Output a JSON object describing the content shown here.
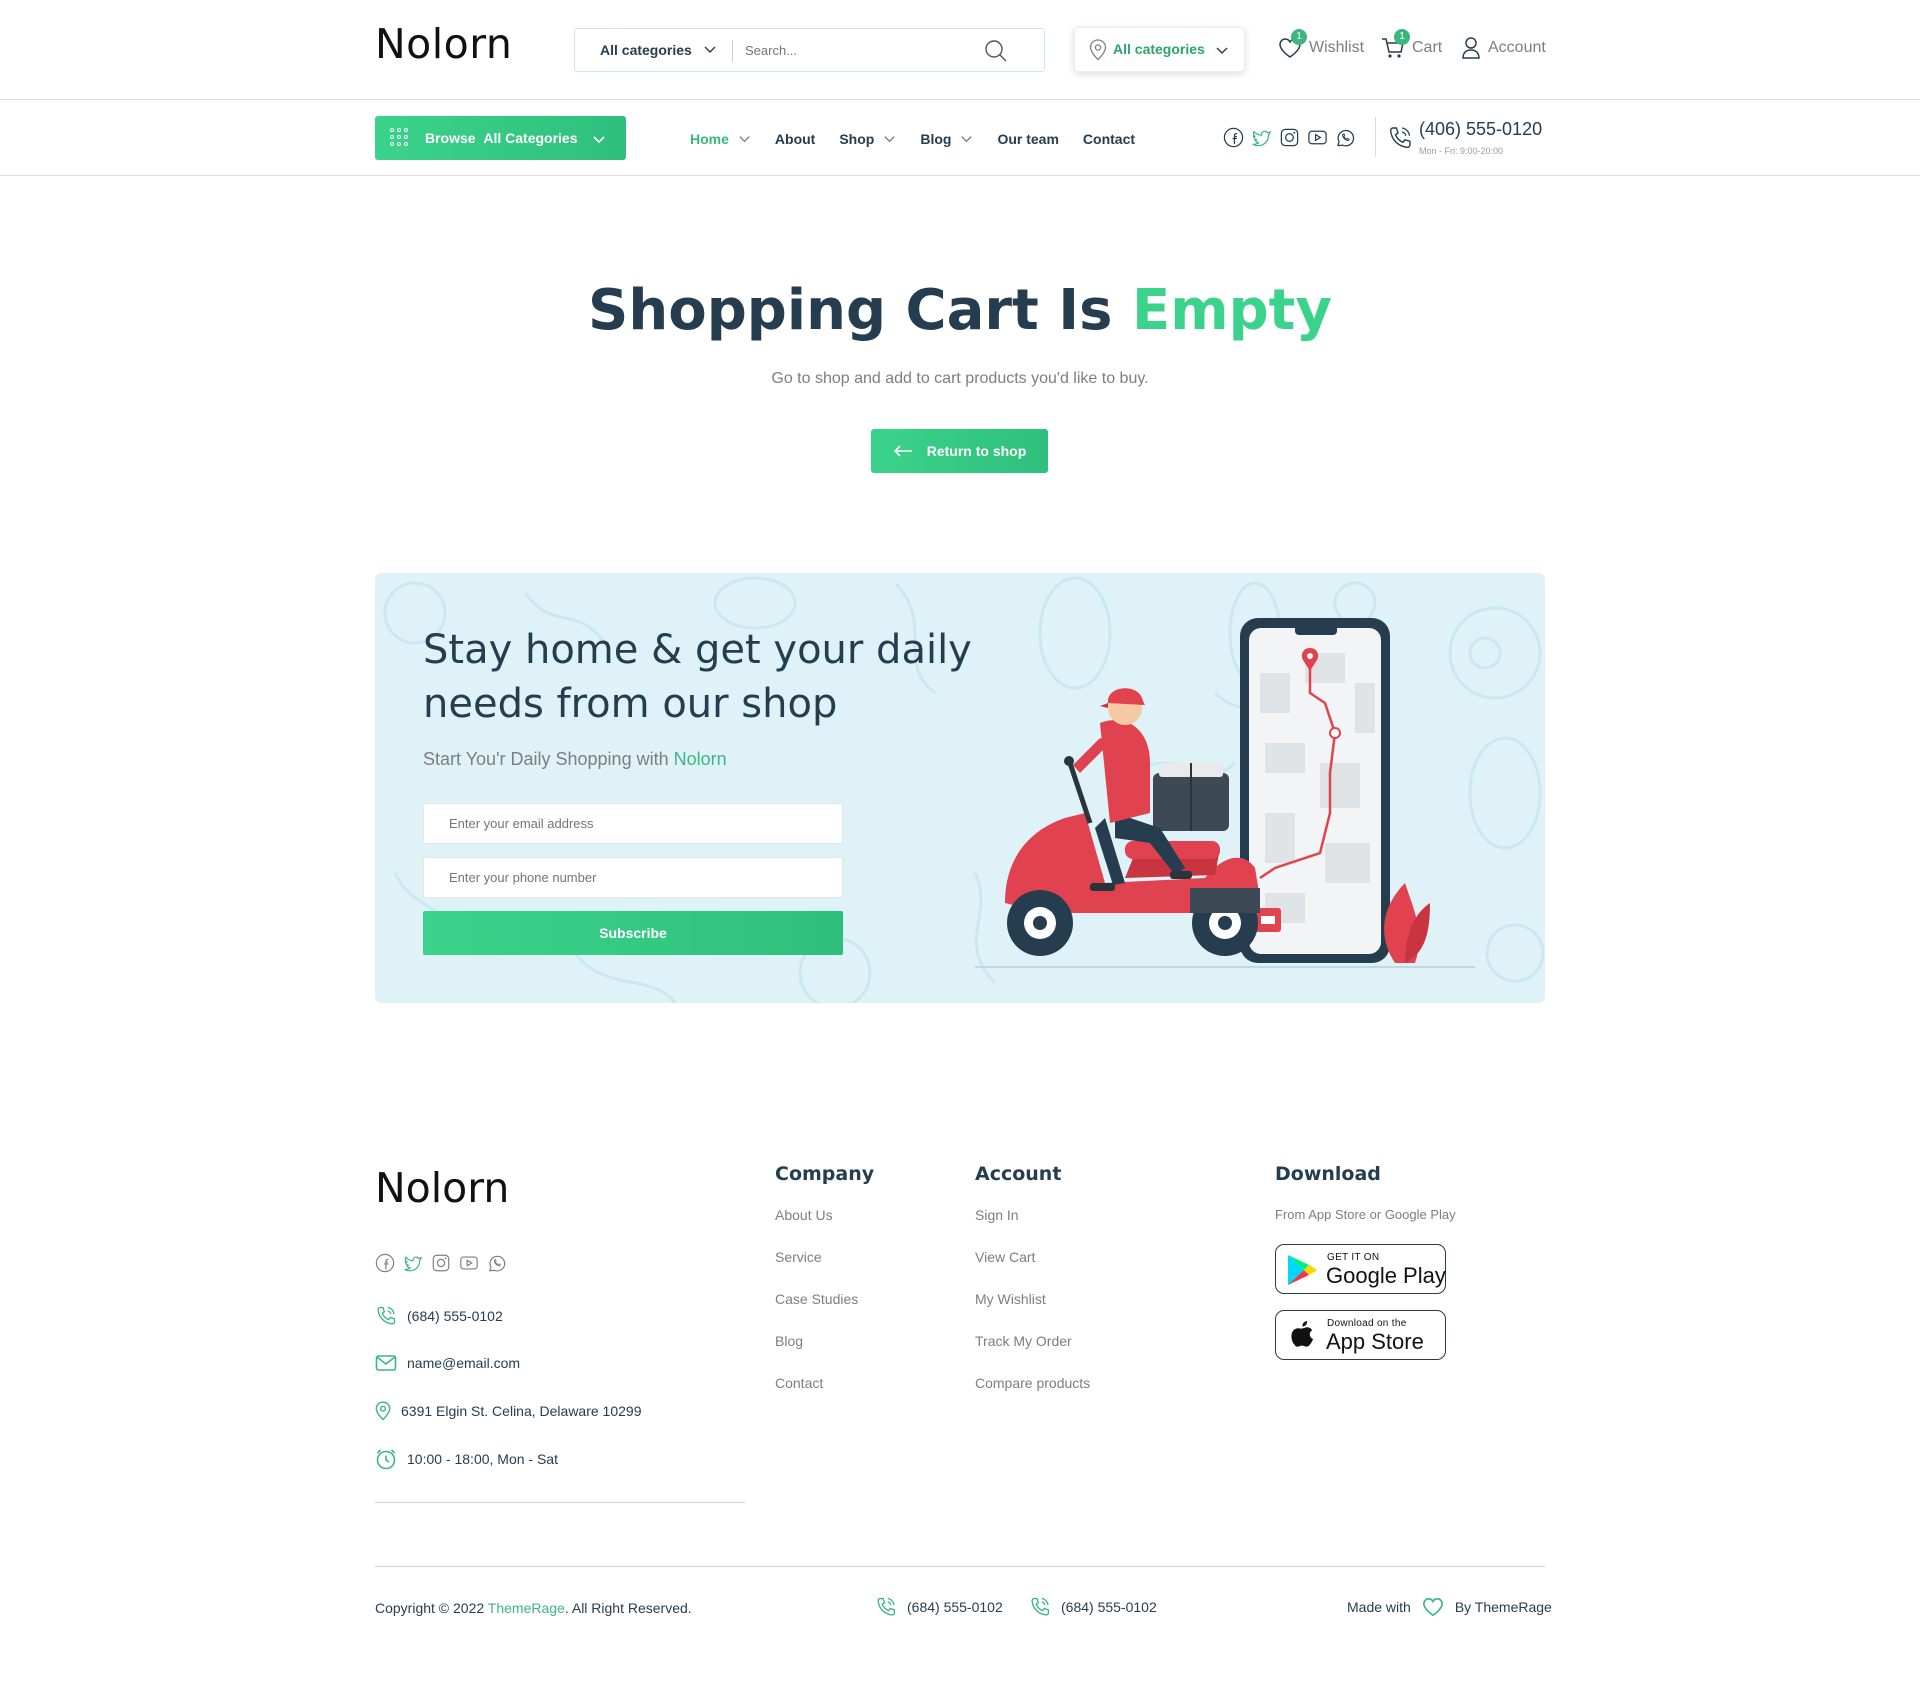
{
  "header": {
    "logo": "Nolorn",
    "search": {
      "category": "All categories",
      "placeholder": "Search..."
    },
    "location": "All categories",
    "wishlist": {
      "label": "Wishlist",
      "count": "1"
    },
    "cart": {
      "label": "Cart",
      "count": "1"
    },
    "account": {
      "label": "Account"
    }
  },
  "nav": {
    "browse_prefix": "Browse",
    "browse_label": "All Categories",
    "items": [
      {
        "label": "Home"
      },
      {
        "label": "About"
      },
      {
        "label": "Shop"
      },
      {
        "label": "Blog"
      },
      {
        "label": "Our team"
      },
      {
        "label": "Contact"
      }
    ],
    "phone": "(406) 555-0120",
    "hours": "Mon - Fri: 9:00-20:00"
  },
  "hero": {
    "title_main": "Shopping Cart Is",
    "title_accent": "Empty",
    "subtitle": "Go to shop and add to cart products you'd like to buy.",
    "button": "Return to shop"
  },
  "banner": {
    "heading": "Stay home & get your daily needs from our shop",
    "tagline": "Start You'r Daily Shopping with",
    "tagline_brand": "Nolorn",
    "email_placeholder": "Enter your email address",
    "phone_placeholder": "Enter your phone number",
    "subscribe": "Subscribe"
  },
  "footer": {
    "logo": "Nolorn",
    "phone": "(684) 555-0102",
    "email": "name@email.com",
    "address": "6391 Elgin St. Celina, Delaware 10299",
    "hours": "10:00 - 18:00, Mon - Sat",
    "company": {
      "title": "Company",
      "links": [
        "About Us",
        "Service",
        "Case Studies",
        "Blog",
        "Contact"
      ]
    },
    "account": {
      "title": "Account",
      "links": [
        "Sign In",
        "View Cart",
        "My Wishlist",
        "Track My Order",
        "Compare products"
      ]
    },
    "download": {
      "title": "Download",
      "desc": "From App Store or Google Play",
      "google_small": "GET IT ON",
      "google_big": "Google Play",
      "apple_small": "Download on the",
      "apple_big": "App Store"
    },
    "copyright_pre": "Copyright © 2022",
    "copyright_brand": "ThemeRage",
    "copyright_post": ". All Right Reserved.",
    "phone1": "(684) 555-0102",
    "phone2": "(684) 555-0102",
    "made_with": "Made with",
    "made_by": "By ThemeRage"
  },
  "colors": {
    "accent": "#3bb77e",
    "accent_light": "#3bd38b",
    "heading": "#253d4e",
    "muted": "#7e7e7e",
    "banner_bg": "#dff2f8"
  }
}
